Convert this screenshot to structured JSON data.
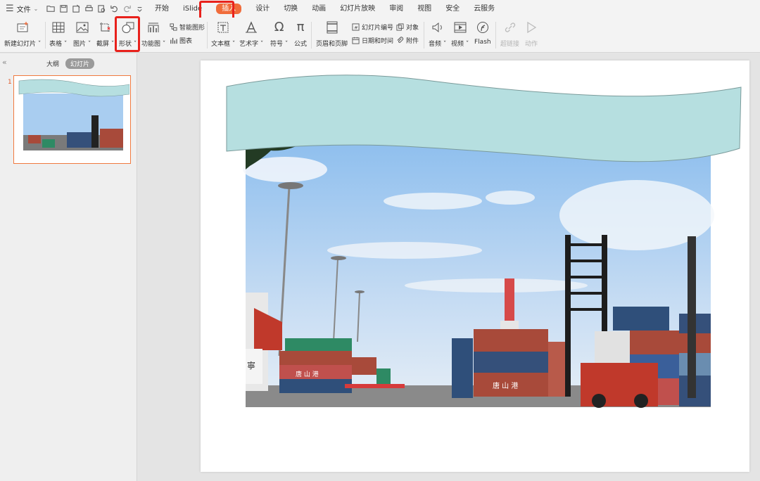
{
  "menubar": {
    "file_label": "文件",
    "tabs": [
      "开始",
      "iSlide",
      "插入",
      "设计",
      "切换",
      "动画",
      "幻灯片放映",
      "审阅",
      "视图",
      "安全",
      "云服务"
    ],
    "active_tab": "插入"
  },
  "ribbon": {
    "new_slide": "新建幻灯片",
    "table": "表格",
    "picture": "图片",
    "screenshot": "截屏",
    "shape": "形状",
    "function_chart": "功能图",
    "smart_art": "智能图形",
    "chart": "图表",
    "text_box": "文本框",
    "word_art": "艺术字",
    "symbol": "符号",
    "formula": "公式",
    "header_footer": "页眉和页脚",
    "slide_number": "幻灯片编号",
    "object": "对象",
    "date_time": "日期和时间",
    "attachment": "附件",
    "audio": "音频",
    "video": "视频",
    "flash": "Flash",
    "hyperlink": "超链接",
    "action": "动作"
  },
  "left_panel": {
    "outline_tab": "大纲",
    "slides_tab": "幻灯片",
    "slide_number": "1"
  },
  "colors": {
    "accent": "#f06c3b",
    "highlight": "#e8211c",
    "banner": "#b6dfe0",
    "sky": "#a9cdf0"
  },
  "slide": {
    "image_sign_text": "唐山港"
  }
}
